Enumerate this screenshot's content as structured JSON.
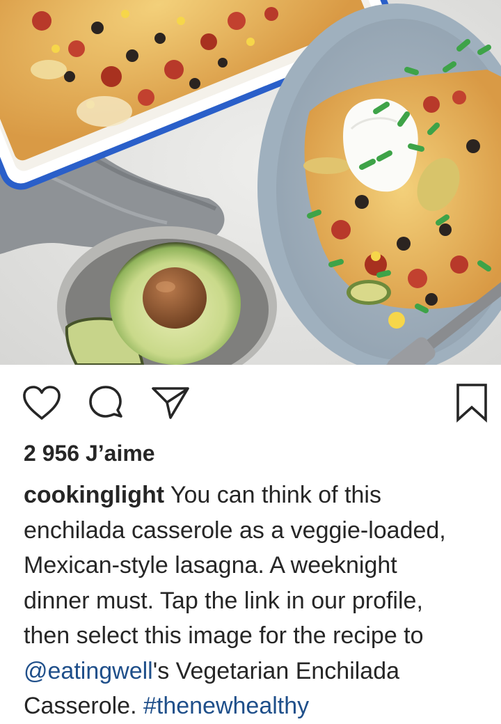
{
  "post": {
    "image": {
      "subject": "enchilada-casserole-photo",
      "elements": [
        "baking-dish-casserole",
        "plate-with-sour-cream-and-scallions",
        "avocado-half-in-bowl",
        "grey-napkin",
        "fork"
      ]
    },
    "actions": {
      "like_icon": "heart-outline-icon",
      "comment_icon": "speech-bubble-icon",
      "share_icon": "paper-plane-icon",
      "save_icon": "bookmark-outline-icon"
    },
    "likes": "2 956 J’aime",
    "caption": {
      "username": "cookinglight",
      "line1_rest": " You can think of this",
      "line2": "enchilada casserole as a veggie-loaded,",
      "line3": "Mexican-style lasagna. A weeknight",
      "line4": "dinner must. Tap the link in our profile,",
      "line5": "then select this image for the recipe to",
      "mention": "@eatingwell",
      "line6_rest": "'s Vegetarian Enchilada",
      "line7_start": "Casserole. ",
      "hashtag": "#thenewhealthy"
    }
  },
  "colors": {
    "text": "#262626",
    "link": "#1f4f8a",
    "background": "#ffffff",
    "dish_rim": "#2a5fc9"
  }
}
